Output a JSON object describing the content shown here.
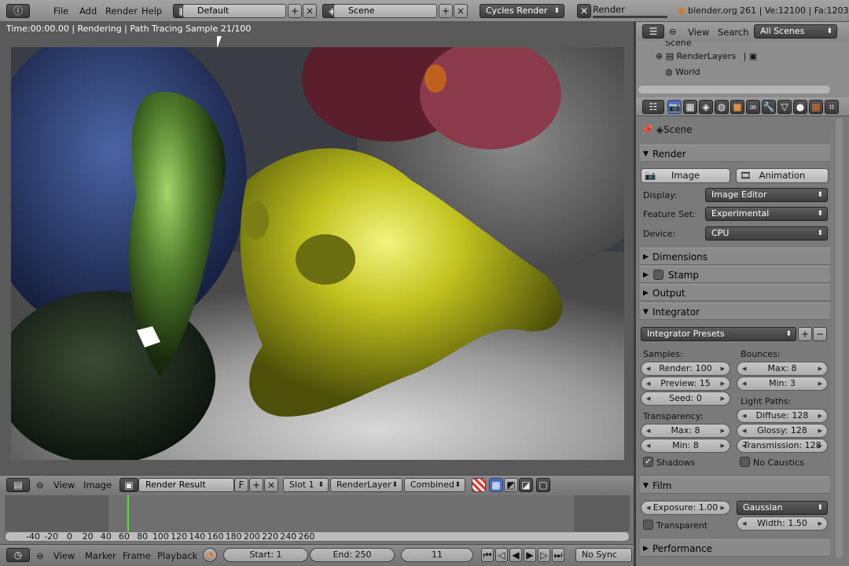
{
  "topbar": {
    "menus": [
      "File",
      "Add",
      "Render",
      "Help"
    ],
    "layout": "Default",
    "scene": "Scene",
    "engine": "Cycles Render",
    "render_tab": "Render",
    "stats": "blender.org 261 | Ve:12100 | Fa:12034"
  },
  "viewport": {
    "info": "Time:00:00.00 | Rendering | Path Tracing Sample 21/100"
  },
  "image_header": {
    "view": "View",
    "image": "Image",
    "image_name": "Render Result",
    "f_flag": "F",
    "slot": "Slot 1",
    "layer": "RenderLayer",
    "pass": "Combined"
  },
  "timeline": {
    "ticks": [
      "-40",
      "-20",
      "0",
      "20",
      "40",
      "60",
      "80",
      "100",
      "120",
      "140",
      "160",
      "180",
      "200",
      "220",
      "240",
      "260"
    ],
    "current_frame": 11
  },
  "timeline_bar": {
    "view": "View",
    "marker": "Marker",
    "frame": "Frame",
    "playback": "Playback",
    "start": "Start: 1",
    "end": "End: 250",
    "current": "11",
    "sync": "No Sync"
  },
  "outliner": {
    "view": "View",
    "search": "Search",
    "filter": "All Scenes",
    "items": [
      "Scene",
      "RenderLayers",
      "World"
    ]
  },
  "properties": {
    "context": "Scene",
    "render_panel": {
      "title": "Render",
      "image_btn": "Image",
      "animation_btn": "Animation",
      "display_label": "Display:",
      "display_value": "Image Editor",
      "feature_label": "Feature Set:",
      "feature_value": "Experimental",
      "device_label": "Device:",
      "device_value": "CPU"
    },
    "collapsed": [
      "Dimensions",
      "Stamp",
      "Output"
    ],
    "integrator": {
      "title": "Integrator",
      "presets": "Integrator Presets",
      "samples_label": "Samples:",
      "render": "Render: 100",
      "preview": "Preview: 15",
      "seed": "Seed: 0",
      "bounces_label": "Bounces:",
      "max": "Max: 8",
      "min": "Min: 3",
      "transparency_label": "Transparency:",
      "t_max": "Max: 8",
      "t_min": "Min: 8",
      "lightpaths_label": "Light Paths:",
      "diffuse": "Diffuse: 128",
      "glossy": "Glossy: 128",
      "transmission": "Transmission: 128",
      "shadows": "Shadows",
      "no_caustics": "No Caustics"
    },
    "film": {
      "title": "Film",
      "exposure": "Exposure: 1.00",
      "filter": "Gaussian",
      "transparent": "Transparent",
      "width": "Width: 1.50"
    },
    "performance": "Performance"
  },
  "colors": {
    "current_frame_line": "#5bdc3b",
    "monkey": "#b8c21a"
  }
}
